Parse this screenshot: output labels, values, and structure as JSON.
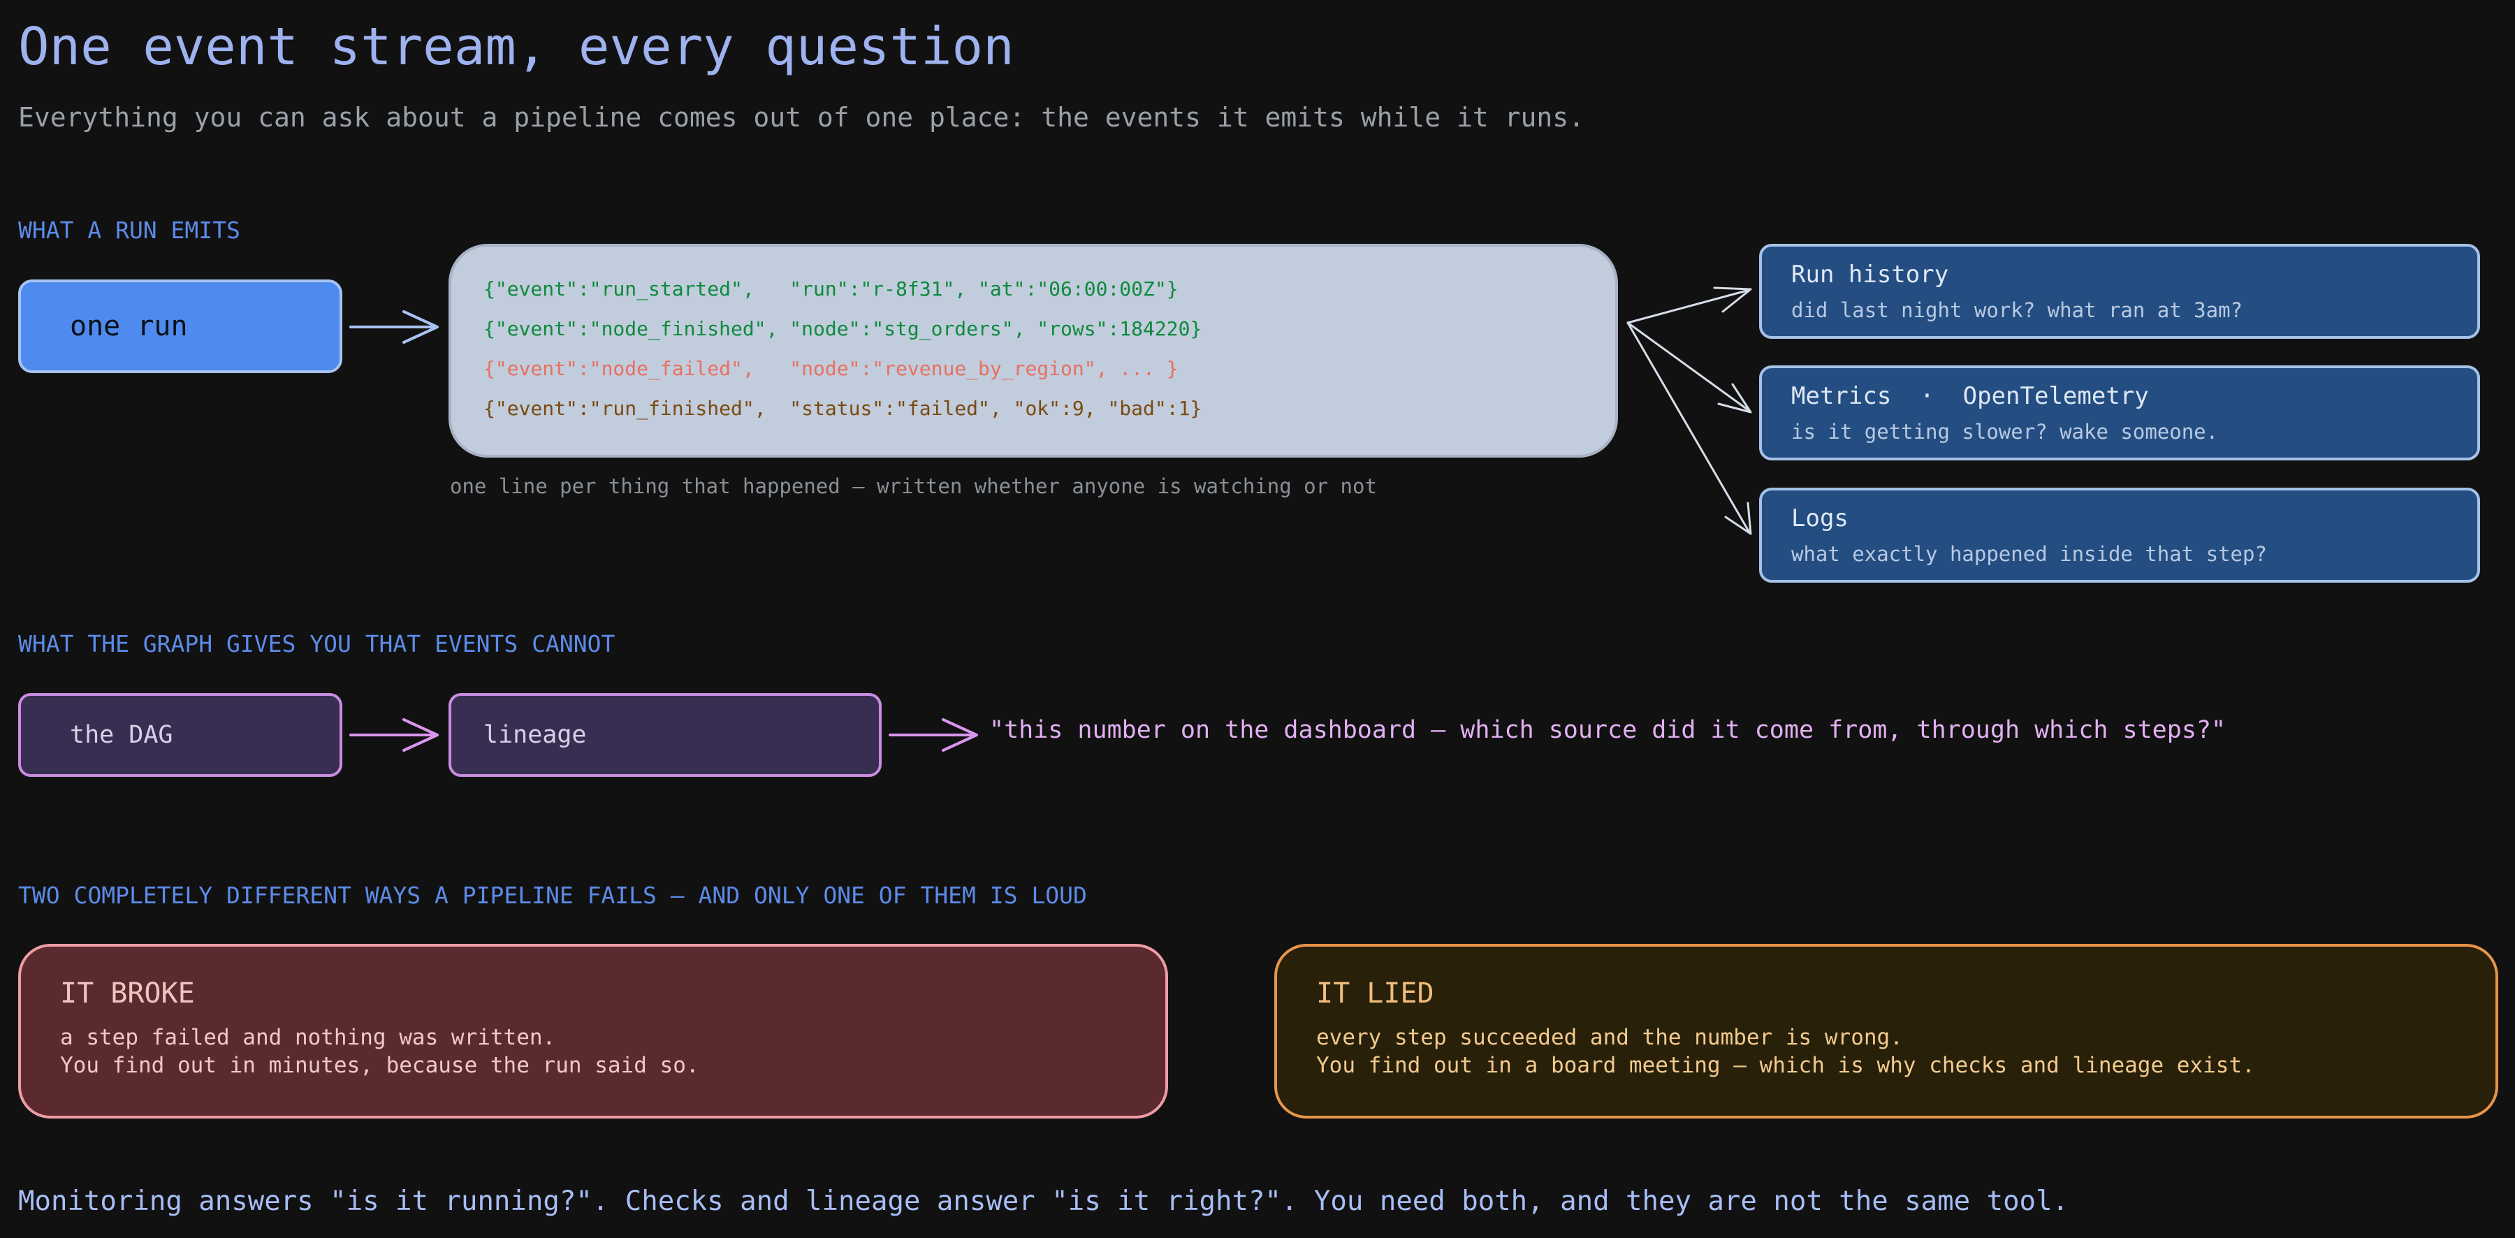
{
  "header": {
    "title": "One event stream, every question",
    "subtitle": "Everything you can ask about a pipeline comes out of one place: the events it emits while it runs."
  },
  "sections": {
    "emits": "WHAT A RUN EMITS",
    "graph": "WHAT THE GRAPH GIVES YOU THAT EVENTS CANNOT",
    "fails": "TWO COMPLETELY DIFFERENT WAYS A PIPELINE FAILS — AND ONLY ONE OF THEM IS LOUD"
  },
  "run_box": {
    "label": "one run"
  },
  "event_stream": {
    "lines": [
      "{\"event\":\"run_started\",   \"run\":\"r-8f31\", \"at\":\"06:00:00Z\"}",
      "{\"event\":\"node_finished\", \"node\":\"stg_orders\", \"rows\":184220}",
      "{\"event\":\"node_failed\",   \"node\":\"revenue_by_region\", ... }",
      "{\"event\":\"run_finished\",  \"status\":\"failed\", \"ok\":9, \"bad\":1}"
    ],
    "line_colors": [
      "#0d8a3c",
      "#0d8a3c",
      "#e8705f",
      "#7a4a10"
    ],
    "caption": "one line per thing that happened — written whether anyone is watching or not"
  },
  "outputs": [
    {
      "title": "Run history",
      "subtitle": "did last night work? what ran at 3am?"
    },
    {
      "title": "Metrics  ·  OpenTelemetry",
      "subtitle": "is it getting slower? wake someone."
    },
    {
      "title": "Logs",
      "subtitle": "what exactly happened inside that step?"
    }
  ],
  "graph": {
    "dag_label": "the DAG",
    "lineage_label": "lineage",
    "quote": "\"this number on the dashboard — which source did it come from, through which steps?\""
  },
  "failures": {
    "broke": {
      "title": "IT BROKE",
      "line1": "a step failed and nothing was written.",
      "line2": "You find out in minutes, because the run said so."
    },
    "lied": {
      "title": "IT LIED",
      "line1": "every step succeeded and the number is wrong.",
      "line2": "You find out in a board meeting — which is why checks and lineage exist."
    }
  },
  "footer": "Monitoring answers \"is it running?\". Checks and lineage answer \"is it right?\". You need both, and they are not the same tool.",
  "colors": {
    "background": "#111111",
    "run_box": "#4f8bee",
    "stream_box": "#c1ccdc",
    "output_card": "#244e82",
    "graph_box": "#372e52",
    "graph_accent": "#c98ce0",
    "broke_card": "#5a2a2f",
    "lied_card": "#282009"
  }
}
